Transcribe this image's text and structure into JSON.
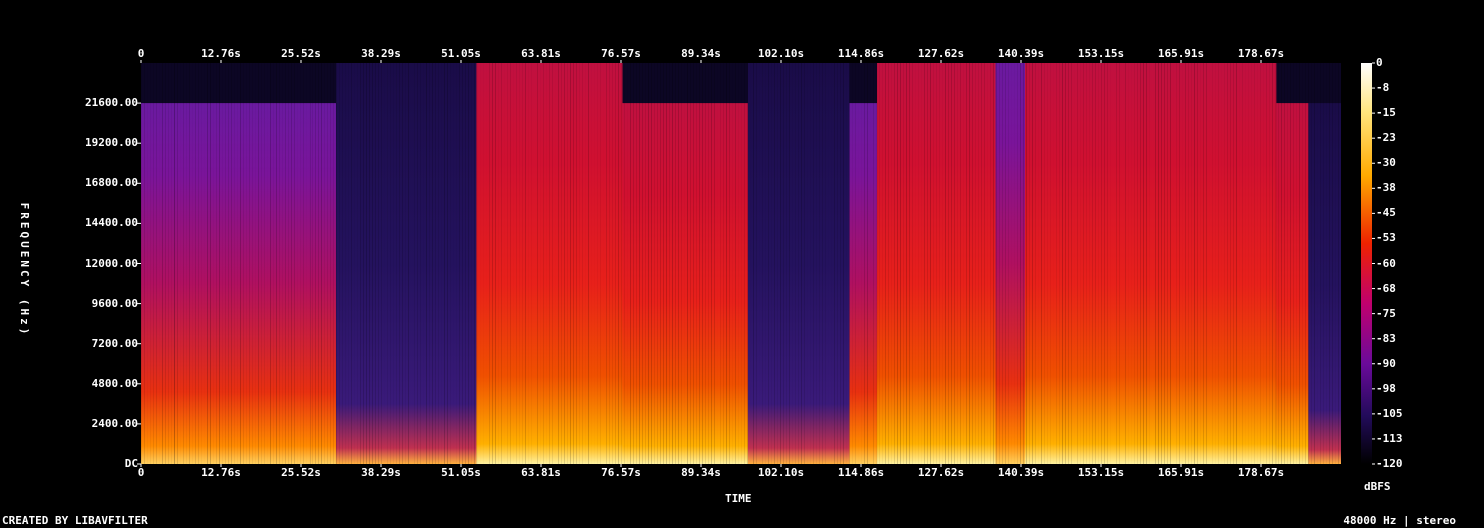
{
  "chart_data": {
    "type": "heatmap",
    "xlabel": "TIME",
    "ylabel": "FREQUENCY (Hz)",
    "x_ticks": [
      "0",
      "12.76s",
      "25.52s",
      "38.29s",
      "51.05s",
      "63.81s",
      "76.57s",
      "89.34s",
      "102.10s",
      "114.86s",
      "127.62s",
      "140.39s",
      "153.15s",
      "165.91s",
      "178.67s"
    ],
    "y_ticks": [
      "DC",
      "2400.00",
      "4800.00",
      "7200.00",
      "9600.00",
      "12000.00",
      "14400.00",
      "16800.00",
      "19200.00",
      "21600.00"
    ],
    "colorbar_ticks": [
      "0",
      "-8",
      "-15",
      "-23",
      "-30",
      "-38",
      "-45",
      "-53",
      "-60",
      "-68",
      "-75",
      "-83",
      "-90",
      "-98",
      "-105",
      "-113",
      "-120"
    ],
    "colorbar_unit": "dBFS",
    "xlim": [
      0,
      191.4
    ],
    "ylim": [
      0,
      24000
    ],
    "segments": [
      {
        "start": 0.0,
        "end": 5.3,
        "level": 0.55,
        "cutoff": 21600
      },
      {
        "start": 5.3,
        "end": 27.0,
        "level": 0.62,
        "cutoff": 21600
      },
      {
        "start": 27.0,
        "end": 31.1,
        "level": 0.7,
        "cutoff": 21600
      },
      {
        "start": 31.1,
        "end": 32.7,
        "level": 0.15,
        "cutoff": 24000
      },
      {
        "start": 32.7,
        "end": 48.4,
        "level": 0.3,
        "cutoff": 24000
      },
      {
        "start": 48.4,
        "end": 53.5,
        "level": 0.3,
        "cutoff": 24000
      },
      {
        "start": 53.5,
        "end": 76.8,
        "level": 0.86,
        "cutoff": 24000
      },
      {
        "start": 76.8,
        "end": 96.8,
        "level": 0.9,
        "cutoff": 21600
      },
      {
        "start": 96.8,
        "end": 113.0,
        "level": 0.48,
        "cutoff": 24000
      },
      {
        "start": 113.0,
        "end": 117.4,
        "level": 0.8,
        "cutoff": 21600
      },
      {
        "start": 117.4,
        "end": 136.3,
        "level": 0.88,
        "cutoff": 24000
      },
      {
        "start": 136.3,
        "end": 141.0,
        "level": 0.55,
        "cutoff": 24000
      },
      {
        "start": 141.0,
        "end": 181.1,
        "level": 0.92,
        "cutoff": 24000
      },
      {
        "start": 181.1,
        "end": 186.2,
        "level": 0.86,
        "cutoff": 21600
      },
      {
        "start": 186.2,
        "end": 191.4,
        "level": 0.45,
        "cutoff": 21600
      }
    ]
  },
  "footer": {
    "left": "CREATED BY LIBAVFILTER",
    "right": "48000 Hz | stereo"
  }
}
